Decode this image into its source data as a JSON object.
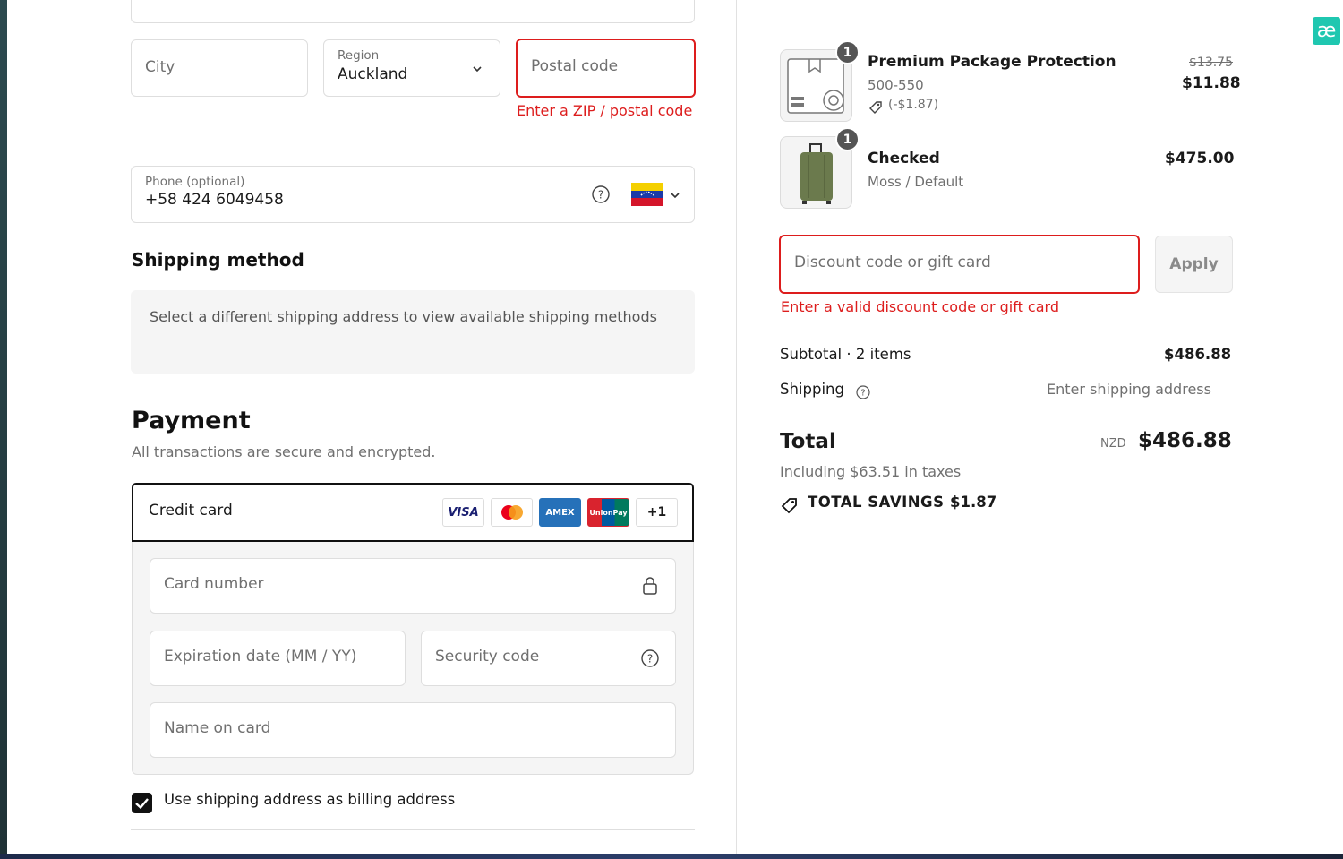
{
  "address": {
    "city_placeholder": "City",
    "region_label": "Region",
    "region_value": "Auckland",
    "postal_placeholder": "Postal code",
    "postal_error": "Enter a ZIP / postal code",
    "phone_label": "Phone (optional)",
    "phone_value": "+58 424 6049458"
  },
  "shipping_method": {
    "title": "Shipping method",
    "notice": "Select a different shipping address to view available shipping methods"
  },
  "payment": {
    "title": "Payment",
    "subtitle": "All transactions are secure and encrypted.",
    "credit_card_label": "Credit card",
    "brands": [
      "VISA",
      "Mastercard",
      "AMEX",
      "UnionPay",
      "+1"
    ],
    "more_brands": "+1",
    "card_number_placeholder": "Card number",
    "expiration_placeholder": "Expiration date (MM / YY)",
    "security_placeholder": "Security code",
    "name_placeholder": "Name on card",
    "billing_checkbox_label": "Use shipping address as billing address",
    "billing_checked": true
  },
  "cart": {
    "items": [
      {
        "name": "Premium Package Protection",
        "variant": "500-550",
        "discount": "(-$1.87)",
        "original_price": "$13.75",
        "price": "$11.88",
        "quantity": "1"
      },
      {
        "name": "Checked",
        "variant": "Moss / Default",
        "price": "$475.00",
        "quantity": "1"
      }
    ],
    "discount_placeholder": "Discount code or gift card",
    "apply_label": "Apply",
    "discount_error": "Enter a valid discount code or gift card",
    "subtotal_label": "Subtotal · 2 items",
    "subtotal_value": "$486.88",
    "shipping_label": "Shipping",
    "shipping_value": "Enter shipping address",
    "total_label": "Total",
    "currency": "NZD",
    "total_value": "$486.88",
    "taxes_note": "Including $63.51 in taxes",
    "savings_label": "TOTAL SAVINGS",
    "savings_value": "$1.87"
  },
  "colors": {
    "error": "#dd1d1d",
    "badge": "#1fc7b0"
  },
  "badge_text": "æ"
}
